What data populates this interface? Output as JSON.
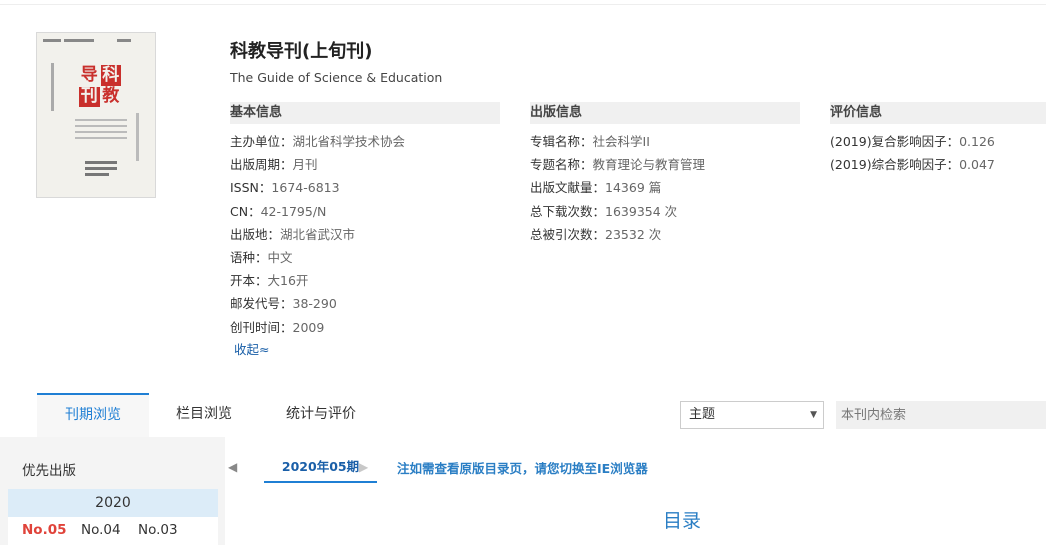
{
  "journal": {
    "title": "科教导刊(上旬刊)",
    "subtitle": "The Guide of Science & Education",
    "cover_chars": [
      "导",
      "科",
      "刊",
      "教"
    ]
  },
  "basic_info": {
    "heading": "基本信息",
    "rows": [
      {
        "label": "主办单位：",
        "value": "湖北省科学技术协会"
      },
      {
        "label": "出版周期：",
        "value": "月刊"
      },
      {
        "label": "ISSN：",
        "value": "1674-6813"
      },
      {
        "label": "CN：",
        "value": "42-1795/N"
      },
      {
        "label": "出版地：",
        "value": "湖北省武汉市"
      },
      {
        "label": "语种：",
        "value": "中文"
      },
      {
        "label": "开本：",
        "value": "大16开"
      },
      {
        "label": "邮发代号：",
        "value": "38-290"
      },
      {
        "label": "创刊时间：",
        "value": "2009"
      }
    ],
    "collapse_label": "收起≈"
  },
  "publish_info": {
    "heading": "出版信息",
    "rows": [
      {
        "label": "专辑名称：",
        "value": "社会科学II"
      },
      {
        "label": "专题名称：",
        "value": "教育理论与教育管理"
      },
      {
        "label": "出版文献量：",
        "value": "14369 篇"
      },
      {
        "label": "总下载次数：",
        "value": "1639354 次"
      },
      {
        "label": "总被引次数：",
        "value": "23532 次"
      }
    ]
  },
  "eval_info": {
    "heading": "评价信息",
    "rows": [
      {
        "label": "(2019)复合影响因子：",
        "value": "0.126"
      },
      {
        "label": "(2019)综合影响因子：",
        "value": "0.047"
      }
    ]
  },
  "tabs": {
    "browse_issue": "刊期浏览",
    "browse_column": "栏目浏览",
    "stats": "统计与评价"
  },
  "search": {
    "field_selected": "主题",
    "placeholder": "本刊内检索"
  },
  "sidebar": {
    "priority_label": "优先出版",
    "year": "2020",
    "issues": [
      "No.05",
      "No.04",
      "No.03"
    ]
  },
  "issue_nav": {
    "prev_arrow": "◀",
    "current": "2020年05期",
    "next_arrow": "▶",
    "note": "注如需查看原版目录页，请您切换至IE浏览器"
  },
  "toc_title": "目录",
  "colors": {
    "accent": "#1f7fd4",
    "link": "#1a5fa8",
    "active_issue": "#e0433a",
    "seal_red": "#c9302c"
  }
}
